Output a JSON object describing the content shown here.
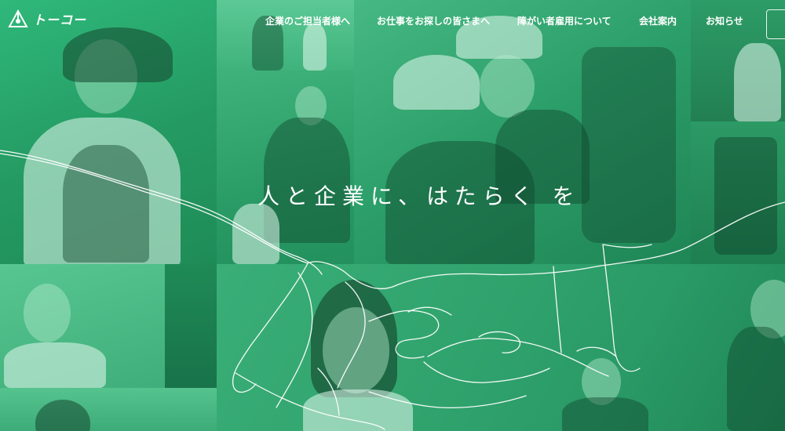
{
  "header": {
    "logo_text": "トーコー",
    "nav": [
      {
        "label": "企業のご担当者様へ"
      },
      {
        "label": "お仕事をお探しの皆さまへ"
      },
      {
        "label": "障がい者雇用について"
      },
      {
        "label": "会社案内"
      },
      {
        "label": "お知らせ"
      }
    ]
  },
  "hero": {
    "headline": "人と企業に、はたらく を"
  },
  "colors": {
    "brand_green": "#2aa56a",
    "text": "#ffffff"
  },
  "icons": {
    "logo": "triangle-logo-icon",
    "menu": "menu-icon"
  }
}
